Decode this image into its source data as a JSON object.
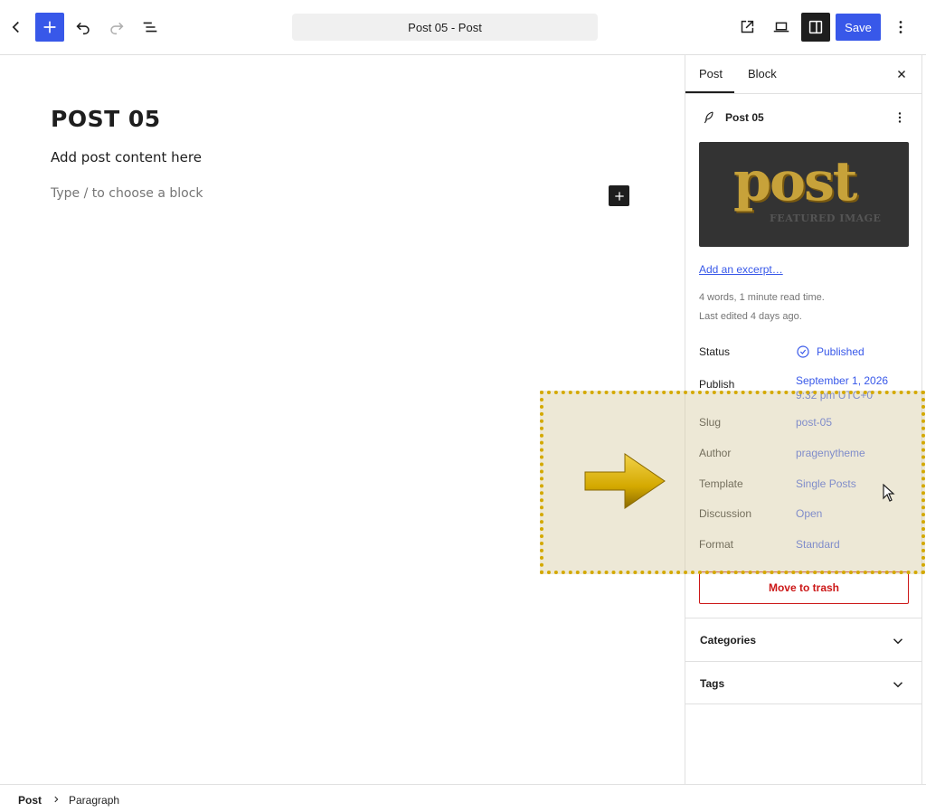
{
  "toolbar": {
    "document_title": "Post 05 - Post",
    "save_label": "Save"
  },
  "editor": {
    "title": "POST 05",
    "paragraph": "Add post content here",
    "placeholder": "Type / to choose a block"
  },
  "sidebar": {
    "tabs": [
      {
        "label": "Post",
        "active": true
      },
      {
        "label": "Block",
        "active": false
      }
    ],
    "post_panel": {
      "title": "Post 05",
      "featured_image": {
        "word": "post",
        "subtitle": "FEATURED IMAGE"
      },
      "excerpt_link": "Add an excerpt…",
      "stats": "4 words, 1 minute read time.",
      "last_edited": "Last edited 4 days ago."
    },
    "rows": {
      "status": {
        "label": "Status",
        "value": "Published"
      },
      "publish": {
        "label": "Publish",
        "value_line1": "September 1, 2026",
        "value_line2": "9:32 pm UTC+0"
      },
      "slug": {
        "label": "Slug",
        "value": "post-05"
      },
      "author": {
        "label": "Author",
        "value": "pragenytheme"
      },
      "template": {
        "label": "Template",
        "value": "Single Posts"
      },
      "discussion": {
        "label": "Discussion",
        "value": "Open"
      },
      "format": {
        "label": "Format",
        "value": "Standard"
      }
    },
    "trash_label": "Move to trash",
    "sections": {
      "categories": "Categories",
      "tags": "Tags"
    }
  },
  "breadcrumb": {
    "root": "Post",
    "leaf": "Paragraph"
  },
  "colors": {
    "accent": "#3858e9",
    "danger": "#cc1818",
    "highlight_border": "#d4a900",
    "arrow": "#d4a900"
  },
  "icons": [
    "back-icon",
    "plus-icon",
    "undo-icon",
    "redo-icon",
    "list-view-icon",
    "external-view-icon",
    "laptop-icon",
    "sidebar-settings-icon",
    "more-vertical-icon",
    "close-icon",
    "feather-icon",
    "check-circle-icon",
    "chevron-down-icon",
    "chevron-right-icon",
    "arrow-right-icon",
    "mouse-cursor-icon"
  ]
}
